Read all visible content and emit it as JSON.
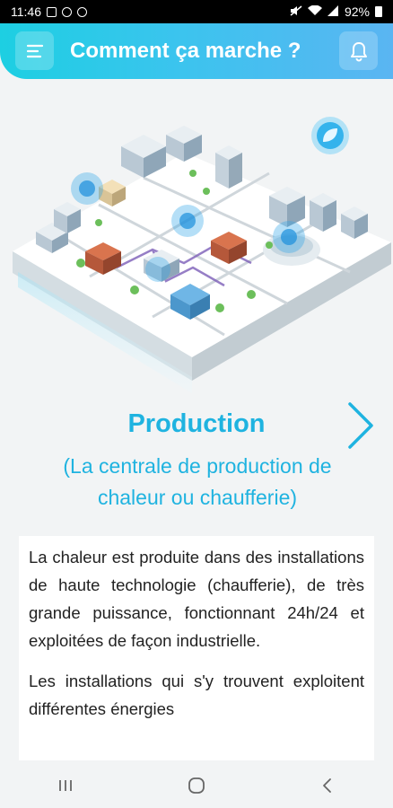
{
  "status_bar": {
    "time": "11:46",
    "battery": "92%"
  },
  "header": {
    "title": "Comment ça marche ?",
    "menu_icon": "menu-icon",
    "bell_icon": "bell-icon"
  },
  "step": {
    "title": "Production",
    "subtitle": "(La centrale de production de chaleur ou chaufferie)",
    "paragraphs": [
      "La chaleur est produite dans des installations de haute technologie (chaufferie), de très grande puissance, fonctionnant 24h/24 et exploitées de façon industrielle.",
      "Les installations qui s'y trouvent exploitent différentes énergies"
    ]
  },
  "nav": {
    "back": "back-icon",
    "home": "home-icon",
    "recents": "recents-icon"
  },
  "colors": {
    "accent": "#1fb3e0",
    "header_start": "#1dcfe2",
    "header_end": "#5ab5f2"
  }
}
